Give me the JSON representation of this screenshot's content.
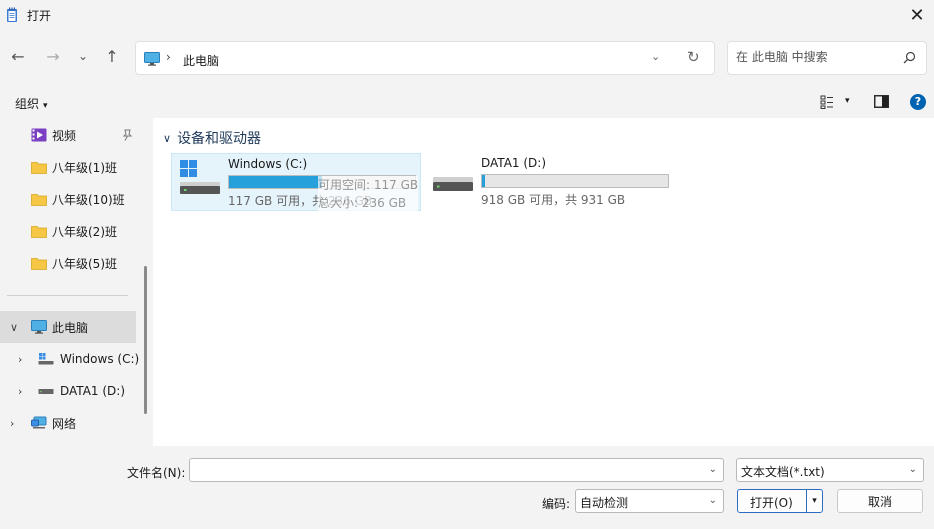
{
  "window": {
    "title": "打开",
    "close_glyph": "✕"
  },
  "nav": {
    "back": "←",
    "forward": "→",
    "recent": "⌄",
    "up": "↑",
    "breadcrumb_sep": "›",
    "breadcrumb": "此电脑",
    "address_dropdown": "⌄",
    "refresh": "↻",
    "search_placeholder": "在 此电脑 中搜索"
  },
  "toolbar": {
    "organize_label": "组织",
    "caret": "▾",
    "view_caret": "▾",
    "help": "?"
  },
  "sidebar": {
    "quick_access": [
      {
        "label": "视频",
        "icon": "video-icon",
        "pinned": true
      },
      {
        "label": "八年级(1)班",
        "icon": "folder-icon"
      },
      {
        "label": "八年级(10)班",
        "icon": "folder-icon"
      },
      {
        "label": "八年级(2)班",
        "icon": "folder-icon"
      },
      {
        "label": "八年级(5)班",
        "icon": "folder-icon"
      }
    ],
    "this_pc": {
      "label": "此电脑",
      "chevron": "∨"
    },
    "drives": [
      {
        "label": "Windows (C:)",
        "chevron": "›"
      },
      {
        "label": "DATA1 (D:)",
        "chevron": "›"
      }
    ],
    "network": {
      "label": "网络",
      "chevron": "›"
    }
  },
  "main": {
    "group_chevron": "∨",
    "group_title": "设备和驱动器",
    "drives": [
      {
        "name": "Windows (C:)",
        "used_fraction": 0.5,
        "info": "117 GB 可用，共 236 GB",
        "selected": true
      },
      {
        "name": "DATA1 (D:)",
        "used_fraction": 0.014,
        "info": "918 GB 可用，共 931 GB",
        "selected": false
      }
    ],
    "tooltip": {
      "line1": "可用空间: 117 GB",
      "line2": "总大小: 236 GB"
    }
  },
  "bottom": {
    "filename_label": "文件名(N):",
    "filename_value": "",
    "filter_value": "文本文档(*.txt)",
    "encoding_label": "编码:",
    "encoding_value": "自动检测",
    "open_label": "打开(O)",
    "cancel_label": "取消",
    "dropdown_glyph": "⌄",
    "split_glyph": "▾"
  },
  "colors": {
    "accent": "#26a0da",
    "folder": "#f6c744",
    "selected_bg": "#e5f3fb"
  }
}
